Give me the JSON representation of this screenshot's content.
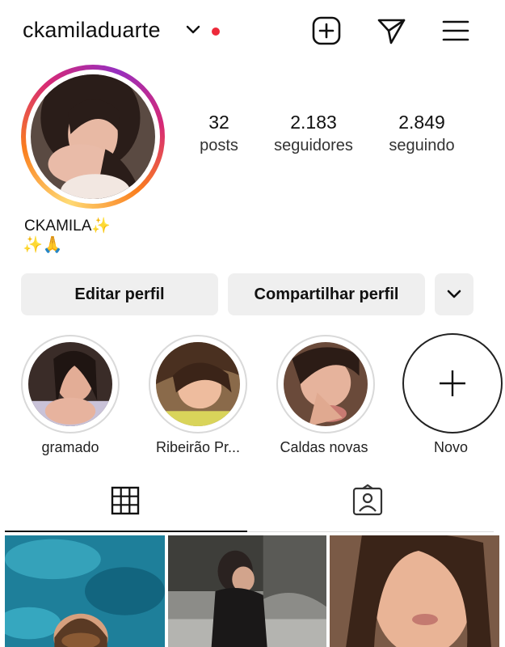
{
  "header": {
    "username": "ckamiladuarte",
    "icons": [
      "chevron-down-icon",
      "notification-dot",
      "add-post-icon",
      "direct-message-icon",
      "menu-icon"
    ],
    "accent_color": "#ed2a3a"
  },
  "profile": {
    "stats": [
      {
        "value": "32",
        "label": "posts"
      },
      {
        "value": "2.183",
        "label": "seguidores"
      },
      {
        "value": "2.849",
        "label": "seguindo"
      }
    ],
    "bio_name": "CKAMILA",
    "bio_emoji_name": "✨",
    "bio_line": "✨🙏"
  },
  "actions": {
    "edit_label": "Editar perfil",
    "share_label": "Compartilhar perfil"
  },
  "highlights": [
    {
      "label": "gramado"
    },
    {
      "label": "Ribeirão Pr..."
    },
    {
      "label": "Caldas novas"
    },
    {
      "label": "Novo"
    }
  ],
  "tabs": [
    "grid-icon",
    "tagged-icon"
  ]
}
